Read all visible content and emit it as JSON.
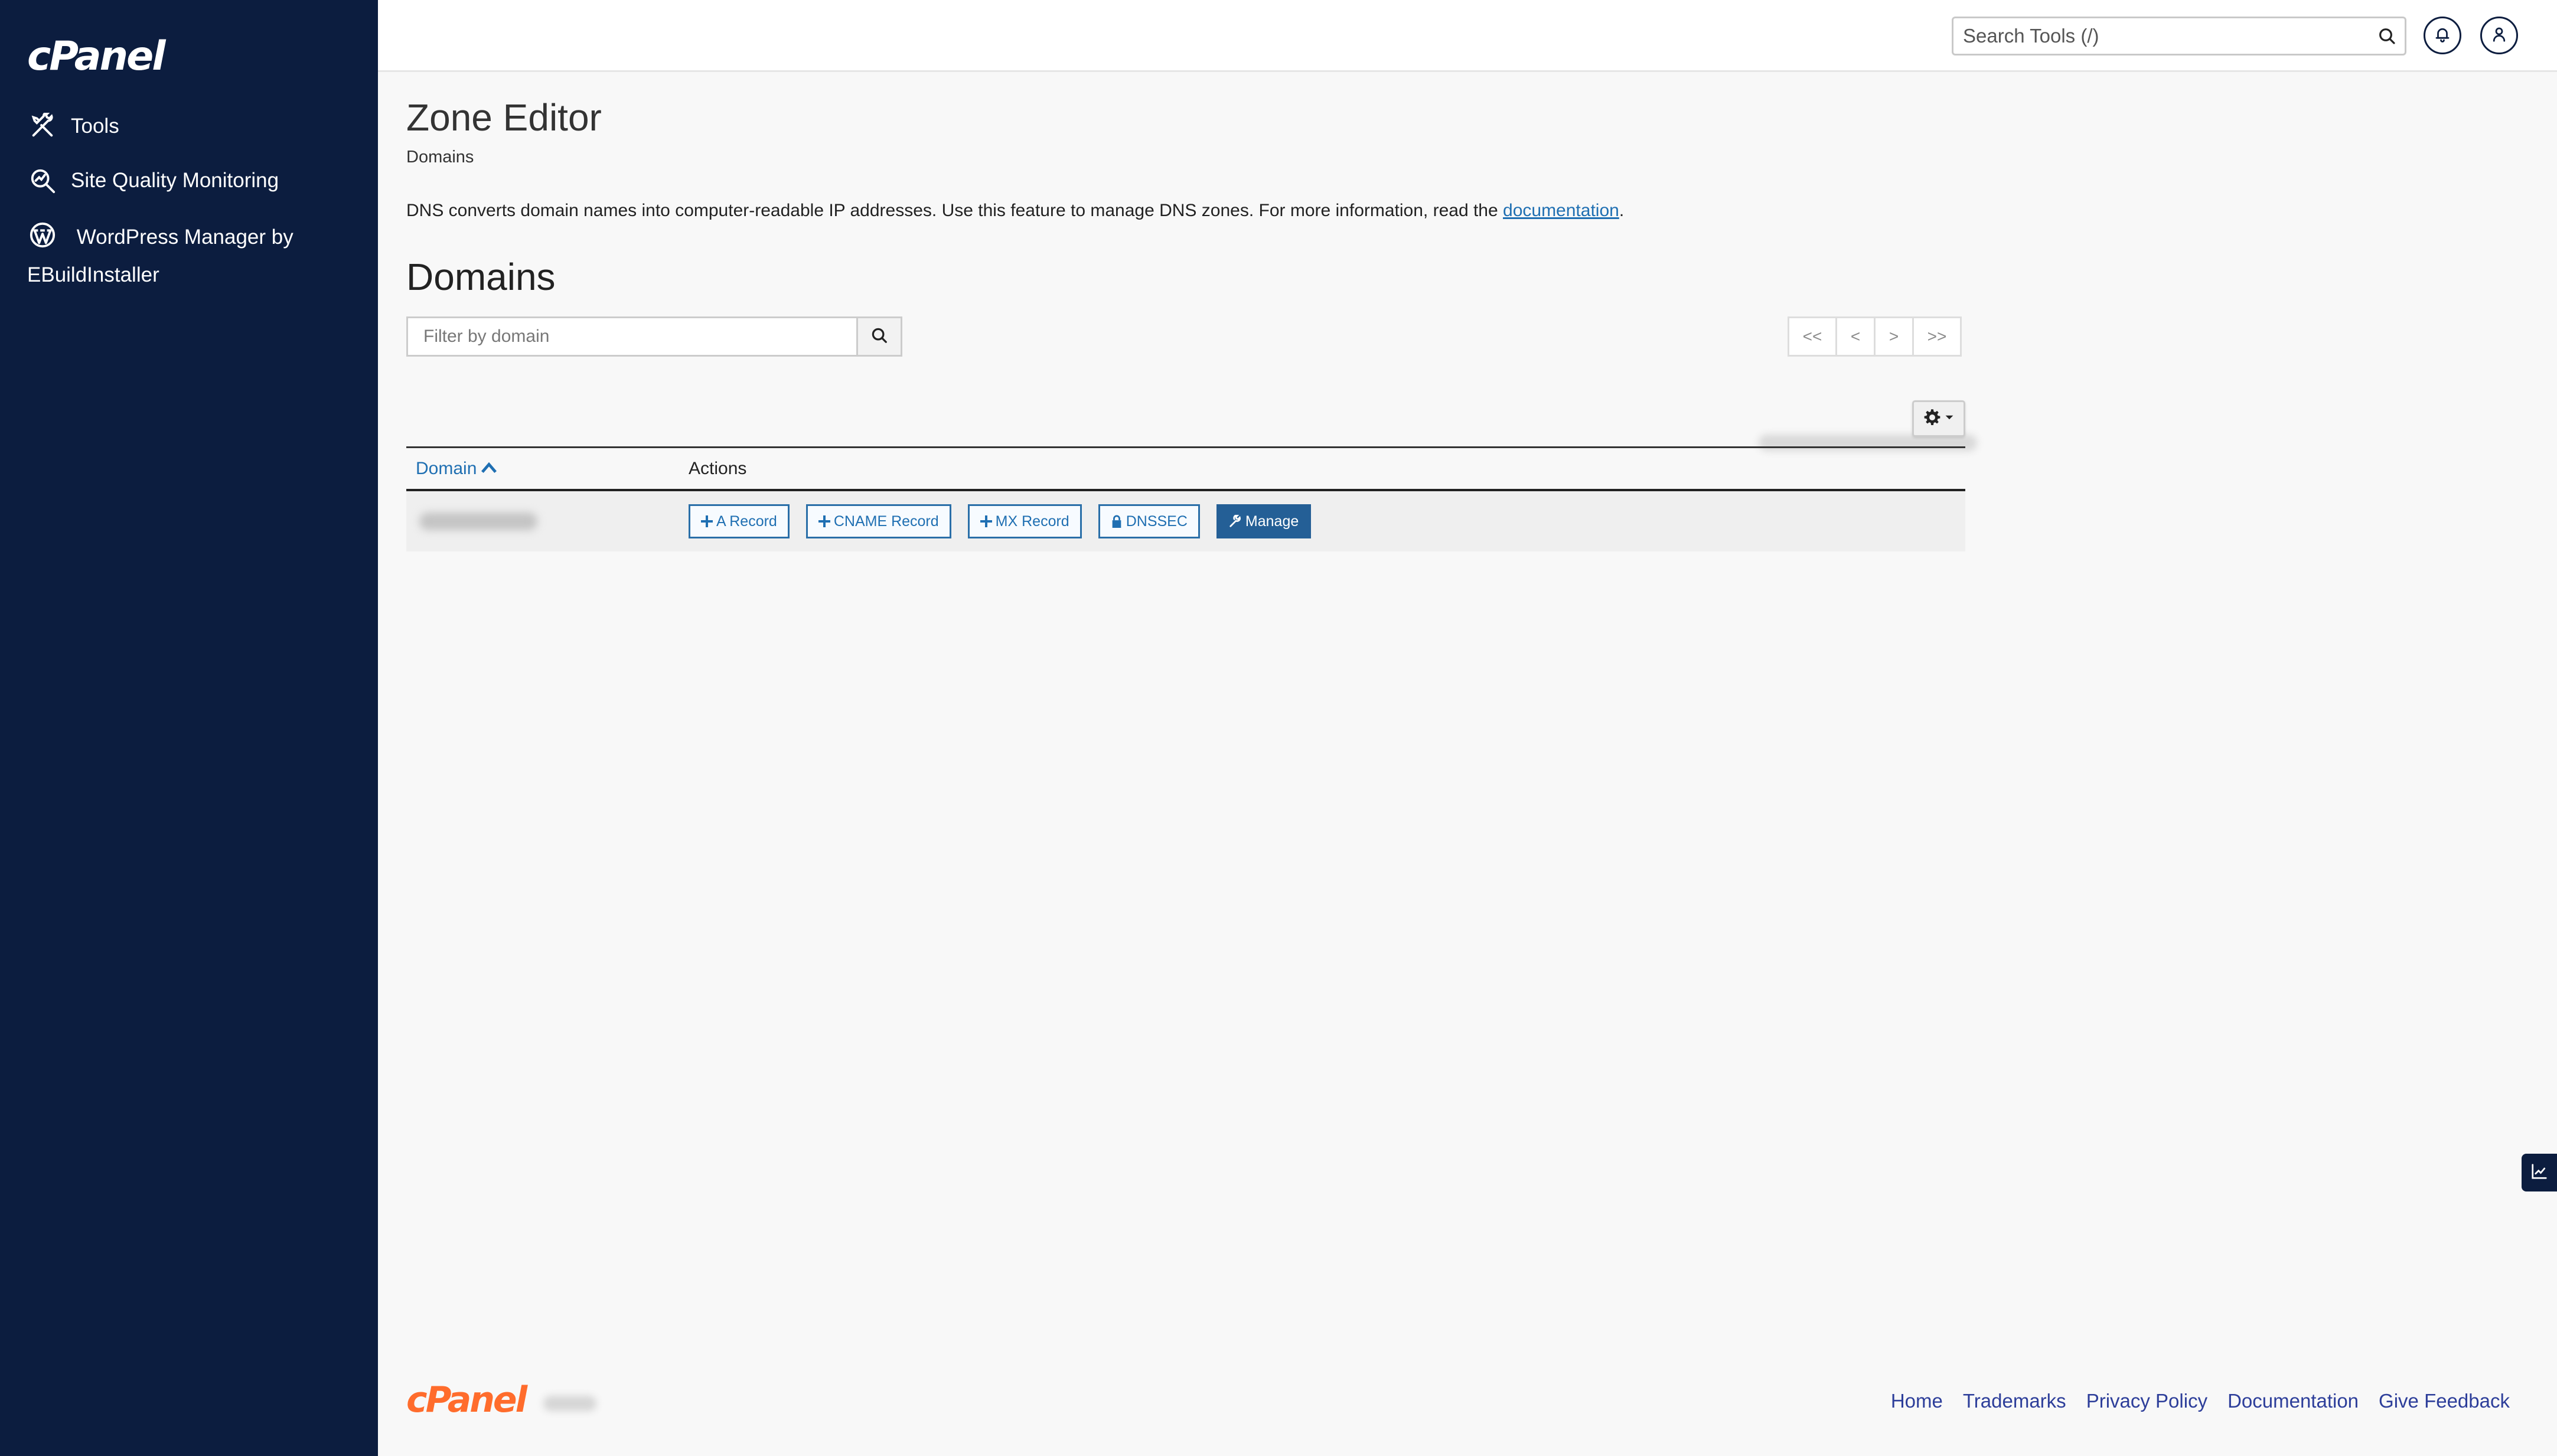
{
  "brand": {
    "logo_text": "cPanel",
    "sidebar_color": "#0c1d3f",
    "accent_color": "#ff6c2c",
    "link_color": "#1f6fb2"
  },
  "sidebar": {
    "items": [
      {
        "label": "Tools",
        "icon": "tools-icon"
      },
      {
        "label": "Site Quality Monitoring",
        "icon": "magnifier-chart-icon"
      },
      {
        "label": "WordPress Manager by EBuildInstaller",
        "icon": "wordpress-icon"
      }
    ]
  },
  "topbar": {
    "search_placeholder": "Search Tools (/)"
  },
  "main": {
    "title": "Zone Editor",
    "breadcrumb": "Domains",
    "description_prefix": "DNS converts domain names into computer-readable IP addresses. Use this feature to manage DNS zones. For more information, read the ",
    "description_link": "documentation",
    "description_suffix": ".",
    "section_title": "Domains",
    "filter_placeholder": "Filter by domain",
    "pager": {
      "first": "<<",
      "prev": "<",
      "next": ">",
      "last": ">>"
    },
    "table": {
      "col_domain": "Domain",
      "col_actions": "Actions",
      "row_actions": {
        "a_record": "A Record",
        "cname_record": "CNAME Record",
        "mx_record": "MX Record",
        "dnssec": "DNSSEC",
        "manage": "Manage"
      }
    }
  },
  "footer": {
    "logo_text": "cPanel",
    "links": [
      "Home",
      "Trademarks",
      "Privacy Policy",
      "Documentation",
      "Give Feedback"
    ]
  }
}
